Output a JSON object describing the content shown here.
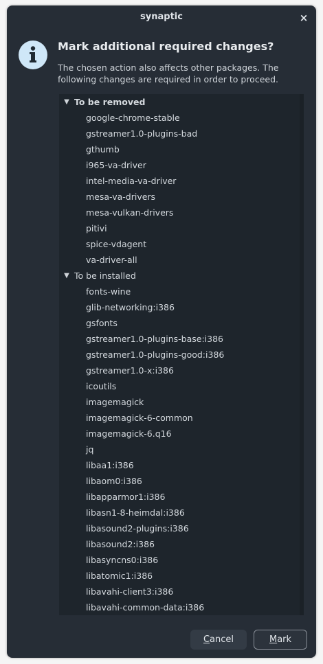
{
  "window": {
    "title": "synaptic",
    "close_glyph": "×"
  },
  "dialog": {
    "icon": "info-icon",
    "heading": "Mark additional required changes?",
    "description": "The chosen action also affects other packages. The following changes are required in order to proceed."
  },
  "tree": {
    "groups": [
      {
        "label": "To be removed",
        "expanded": true,
        "items": [
          "google-chrome-stable",
          "gstreamer1.0-plugins-bad",
          "gthumb",
          "i965-va-driver",
          "intel-media-va-driver",
          "mesa-va-drivers",
          "mesa-vulkan-drivers",
          "pitivi",
          "spice-vdagent",
          "va-driver-all"
        ]
      },
      {
        "label": "To be installed",
        "expanded": true,
        "items": [
          "fonts-wine",
          "glib-networking:i386",
          "gsfonts",
          "gstreamer1.0-plugins-base:i386",
          "gstreamer1.0-plugins-good:i386",
          "gstreamer1.0-x:i386",
          "icoutils",
          "imagemagick",
          "imagemagick-6-common",
          "imagemagick-6.q16",
          "jq",
          "libaa1:i386",
          "libaom0:i386",
          "libapparmor1:i386",
          "libasn1-8-heimdal:i386",
          "libasound2-plugins:i386",
          "libasound2:i386",
          "libasyncns0:i386",
          "libatomic1:i386",
          "libavahi-client3:i386",
          "libavahi-common-data:i386"
        ]
      }
    ]
  },
  "buttons": {
    "cancel": {
      "mnemonic": "C",
      "rest": "ancel"
    },
    "mark": {
      "mnemonic": "M",
      "rest": "ark"
    }
  },
  "colors": {
    "window_bg": "#262d36",
    "tree_bg": "#1e252c",
    "icon_bg": "#cfe7f8",
    "icon_fg": "#1f2a33",
    "text": "#d4d9de"
  }
}
